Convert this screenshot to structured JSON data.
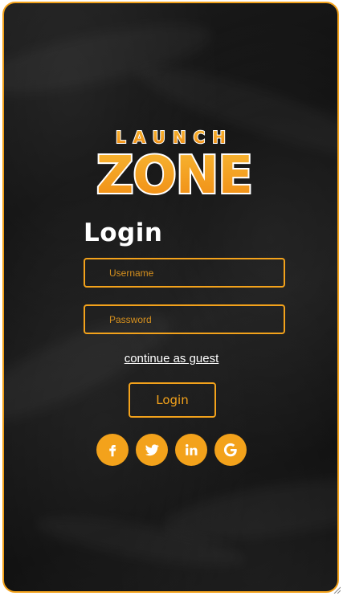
{
  "logo": {
    "line1": "LAUNCH",
    "line2": "ZONE"
  },
  "form": {
    "title": "Login",
    "username_placeholder": "Username",
    "password_placeholder": "Password",
    "guest_link": "continue as guest",
    "login_button": "Login"
  },
  "social": [
    {
      "name": "facebook",
      "icon": "facebook-icon"
    },
    {
      "name": "twitter",
      "icon": "twitter-icon"
    },
    {
      "name": "linkedin",
      "icon": "linkedin-icon"
    },
    {
      "name": "google",
      "icon": "google-icon"
    }
  ],
  "colors": {
    "accent": "#f3a21b",
    "background": "#151515",
    "text": "#ffffff"
  }
}
